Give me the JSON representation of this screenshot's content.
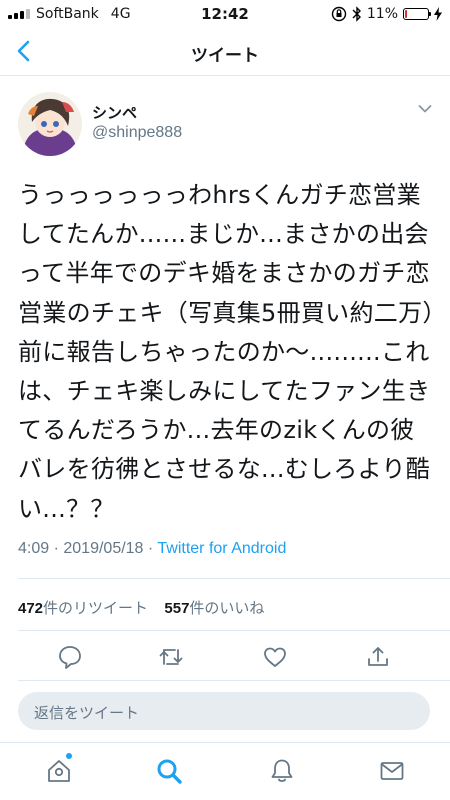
{
  "status_bar": {
    "carrier": "SoftBank",
    "network": "4G",
    "time": "12:42",
    "battery": "11%",
    "battery_level": 0.11
  },
  "nav": {
    "title": "ツイート"
  },
  "tweet": {
    "author_name": "シンペ",
    "author_handle": "@shinpe888",
    "text": "うっっっっっっわhrsくんガチ恋営業してたんか......まじか...まさかの出会って半年でのデキ婚をまさかのガチ恋営業のチェキ（写真集5冊買い約二万）前に報告しちゃったのか〜.........これは、チェキ楽しみにしてたファン生きてるんだろうか...去年のzikくんの彼バレを彷彿とさせるな...むしろより酷い...？？",
    "time": "4:09",
    "date": "2019/05/18",
    "separator": "·",
    "source": "Twitter for Android"
  },
  "stats": {
    "retweet_count": "472",
    "retweet_label": "件のリツイート",
    "like_count": "557",
    "like_label": "件のいいね"
  },
  "reply": {
    "placeholder": "返信をツイート"
  },
  "icons": {
    "back": "chevron-left-icon",
    "caret": "chevron-down-icon",
    "reply": "reply-icon",
    "retweet": "retweet-icon",
    "like": "heart-icon",
    "share": "share-icon",
    "home": "home-icon",
    "search": "search-icon",
    "notifications": "bell-icon",
    "messages": "mail-icon"
  },
  "colors": {
    "accent": "#1da1f2",
    "secondary_text": "#657786",
    "divider": "#e1e8ed",
    "battery_low": "#e0302e"
  }
}
